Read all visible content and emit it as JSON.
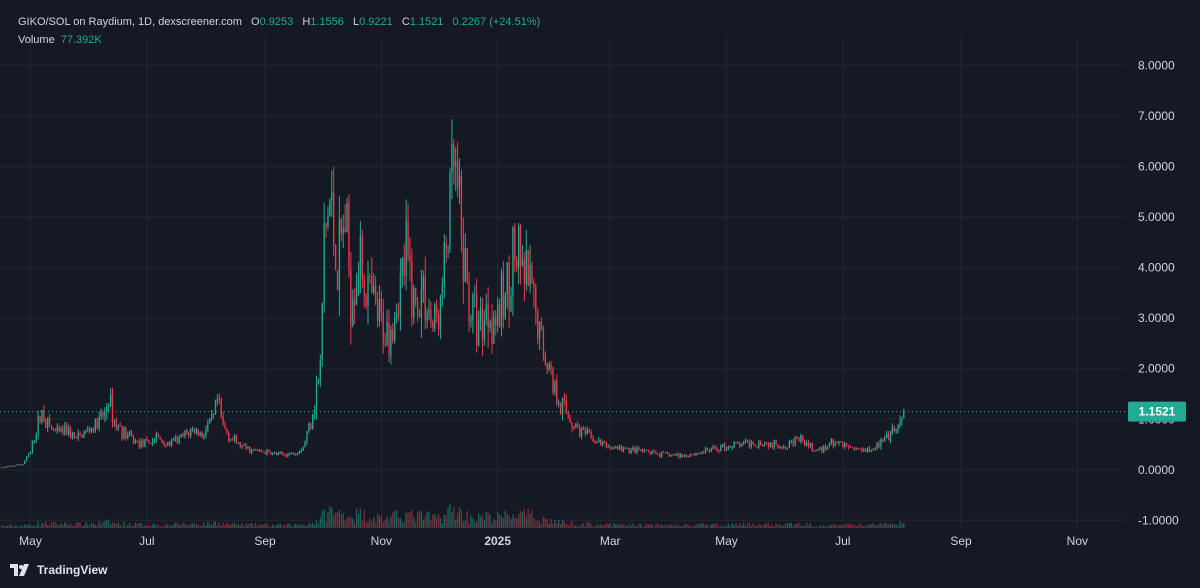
{
  "header": {
    "symbol": "GIKO/SOL on Raydium, 1D, dexscreener.com",
    "open_key": "O",
    "open": "0.9253",
    "high_key": "H",
    "high": "1.1556",
    "low_key": "L",
    "low": "0.9221",
    "close_key": "C",
    "close": "1.1521",
    "change": "0.2267 (+24.51%)",
    "volume_label": "Volume",
    "volume": "77.392K"
  },
  "brand": {
    "name": "TradingView"
  },
  "colors": {
    "up": "#22ab94",
    "down": "#f23645",
    "background": "#151924",
    "grid": "#232632",
    "price_line": "#22ab94"
  },
  "chart_data": {
    "type": "candlestick",
    "title": "GIKO/SOL on Raydium, 1D, dexscreener.com",
    "last_price": 1.1521,
    "last_price_label": "1.1521",
    "ylim": [
      -1.15,
      8.6
    ],
    "y_ticks": [
      -1.0,
      0.0,
      1.0,
      2.0,
      3.0,
      4.0,
      5.0,
      6.0,
      7.0,
      8.0
    ],
    "y_tick_labels": [
      "-1.0000",
      "0.0000",
      "1.0000",
      "2.0000",
      "3.0000",
      "4.0000",
      "5.0000",
      "6.0000",
      "7.0000",
      "8.0000"
    ],
    "x_tick_labels": [
      {
        "label": "May",
        "date": "2024-05-01",
        "bold": false
      },
      {
        "label": "Jul",
        "date": "2024-07-01",
        "bold": false
      },
      {
        "label": "Sep",
        "date": "2024-09-01",
        "bold": false
      },
      {
        "label": "Nov",
        "date": "2024-11-01",
        "bold": false
      },
      {
        "label": "2025",
        "date": "2025-01-01",
        "bold": true
      },
      {
        "label": "Mar",
        "date": "2025-03-01",
        "bold": false
      },
      {
        "label": "May",
        "date": "2025-05-01",
        "bold": false
      },
      {
        "label": "Jul",
        "date": "2025-07-01",
        "bold": false
      },
      {
        "label": "Sep",
        "date": "2025-09-01",
        "bold": false
      },
      {
        "label": "Nov",
        "date": "2025-11-01",
        "bold": false
      }
    ],
    "x_range": [
      "2024-04-15",
      "2025-11-26"
    ],
    "grid": true,
    "series": [
      {
        "name": "GIKO/SOL",
        "kind": "close",
        "points": [
          [
            "2024-04-16",
            0.05
          ],
          [
            "2024-04-22",
            0.08
          ],
          [
            "2024-04-27",
            0.12
          ],
          [
            "2024-05-01",
            0.35
          ],
          [
            "2024-05-04",
            0.8
          ],
          [
            "2024-05-07",
            1.15
          ],
          [
            "2024-05-10",
            0.9
          ],
          [
            "2024-05-15",
            0.7
          ],
          [
            "2024-05-20",
            0.8
          ],
          [
            "2024-05-25",
            0.6
          ],
          [
            "2024-05-30",
            0.75
          ],
          [
            "2024-06-05",
            0.9
          ],
          [
            "2024-06-09",
            1.1
          ],
          [
            "2024-06-11",
            1.45
          ],
          [
            "2024-06-14",
            0.95
          ],
          [
            "2024-06-20",
            0.7
          ],
          [
            "2024-06-25",
            0.55
          ],
          [
            "2024-07-01",
            0.5
          ],
          [
            "2024-07-06",
            0.65
          ],
          [
            "2024-07-12",
            0.5
          ],
          [
            "2024-07-18",
            0.6
          ],
          [
            "2024-07-25",
            0.8
          ],
          [
            "2024-07-30",
            0.7
          ],
          [
            "2024-08-05",
            1.0
          ],
          [
            "2024-08-07",
            1.35
          ],
          [
            "2024-08-10",
            0.85
          ],
          [
            "2024-08-15",
            0.6
          ],
          [
            "2024-08-20",
            0.45
          ],
          [
            "2024-08-26",
            0.38
          ],
          [
            "2024-09-01",
            0.35
          ],
          [
            "2024-09-08",
            0.3
          ],
          [
            "2024-09-15",
            0.32
          ],
          [
            "2024-09-21",
            0.45
          ],
          [
            "2024-09-25",
            1.0
          ],
          [
            "2024-09-30",
            2.0
          ],
          [
            "2024-10-02",
            4.5
          ],
          [
            "2024-10-05",
            5.3
          ],
          [
            "2024-10-09",
            4.0
          ],
          [
            "2024-10-13",
            5.0
          ],
          [
            "2024-10-16",
            3.5
          ],
          [
            "2024-10-20",
            4.2
          ],
          [
            "2024-10-25",
            3.5
          ],
          [
            "2024-10-30",
            3.0
          ],
          [
            "2024-11-04",
            2.7
          ],
          [
            "2024-11-09",
            3.3
          ],
          [
            "2024-11-14",
            4.2
          ],
          [
            "2024-11-19",
            3.2
          ],
          [
            "2024-11-23",
            3.6
          ],
          [
            "2024-11-28",
            2.8
          ],
          [
            "2024-12-02",
            3.2
          ],
          [
            "2024-12-07",
            5.2
          ],
          [
            "2024-12-09",
            6.0
          ],
          [
            "2024-12-13",
            4.5
          ],
          [
            "2024-12-17",
            3.3
          ],
          [
            "2024-12-22",
            2.9
          ],
          [
            "2024-12-27",
            3.2
          ],
          [
            "2025-01-01",
            3.0
          ],
          [
            "2025-01-05",
            3.4
          ],
          [
            "2025-01-09",
            4.3
          ],
          [
            "2025-01-13",
            3.9
          ],
          [
            "2025-01-17",
            3.7
          ],
          [
            "2025-01-21",
            3.0
          ],
          [
            "2025-01-26",
            2.3
          ],
          [
            "2025-01-31",
            1.6
          ],
          [
            "2025-02-05",
            1.2
          ],
          [
            "2025-02-10",
            0.9
          ],
          [
            "2025-02-16",
            0.7
          ],
          [
            "2025-02-22",
            0.55
          ],
          [
            "2025-03-01",
            0.45
          ],
          [
            "2025-03-10",
            0.4
          ],
          [
            "2025-03-20",
            0.35
          ],
          [
            "2025-03-30",
            0.3
          ],
          [
            "2025-04-08",
            0.28
          ],
          [
            "2025-04-18",
            0.35
          ],
          [
            "2025-04-28",
            0.45
          ],
          [
            "2025-05-08",
            0.5
          ],
          [
            "2025-05-18",
            0.55
          ],
          [
            "2025-05-28",
            0.48
          ],
          [
            "2025-06-08",
            0.6
          ],
          [
            "2025-06-18",
            0.35
          ],
          [
            "2025-06-25",
            0.55
          ],
          [
            "2025-07-01",
            0.5
          ],
          [
            "2025-07-09",
            0.4
          ],
          [
            "2025-07-17",
            0.45
          ],
          [
            "2025-07-24",
            0.6
          ],
          [
            "2025-07-28",
            0.75
          ],
          [
            "2025-08-01",
            0.92
          ],
          [
            "2025-08-02",
            1.1521
          ]
        ]
      }
    ],
    "volume": {
      "name": "Volume",
      "last_value": "77.392K"
    }
  }
}
